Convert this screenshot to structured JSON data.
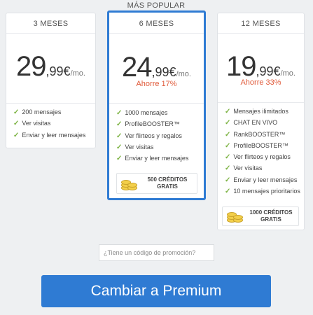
{
  "popular_label": "MÁS POPULAR",
  "plans": [
    {
      "period": "3 MESES",
      "price_int": "29",
      "price_dec": ",99€",
      "price_per": "/mo.",
      "features": [
        "200 mensajes",
        "Ver visitas",
        "Enviar y leer mensajes"
      ]
    },
    {
      "period": "6 MESES",
      "price_int": "24",
      "price_dec": ",99€",
      "price_per": "/mo.",
      "saving": "Ahorre 17%",
      "features": [
        "1000 mensajes",
        "ProfileBOOSTER™",
        "Ver flirteos y regalos",
        "Ver visitas",
        "Enviar y leer mensajes"
      ],
      "credits_line1": "500 CRÉDITOS",
      "credits_line2": "GRATIS"
    },
    {
      "period": "12 MESES",
      "price_int": "19",
      "price_dec": ",99€",
      "price_per": "/mo.",
      "saving": "Ahorre 33%",
      "features": [
        "Mensajes ilimitados",
        "CHAT EN VIVO",
        "RankBOOSTER™",
        "ProfileBOOSTER™",
        "Ver flirteos y regalos",
        "Ver visitas",
        "Enviar y leer mensajes",
        "10 mensajes prioritarios"
      ],
      "credits_line1": "1000 CRÉDITOS",
      "credits_line2": "GRATIS"
    }
  ],
  "promo": {
    "placeholder": "¿Tiene un código de promoción?"
  },
  "cta": {
    "label": "Cambiar a Premium"
  },
  "colors": {
    "accent": "#2f7bd3",
    "saving": "#e05a3a",
    "check": "#7cb342",
    "background": "#eef0f2"
  },
  "icons": {
    "feature": "check-icon",
    "credits": "coins-icon"
  }
}
